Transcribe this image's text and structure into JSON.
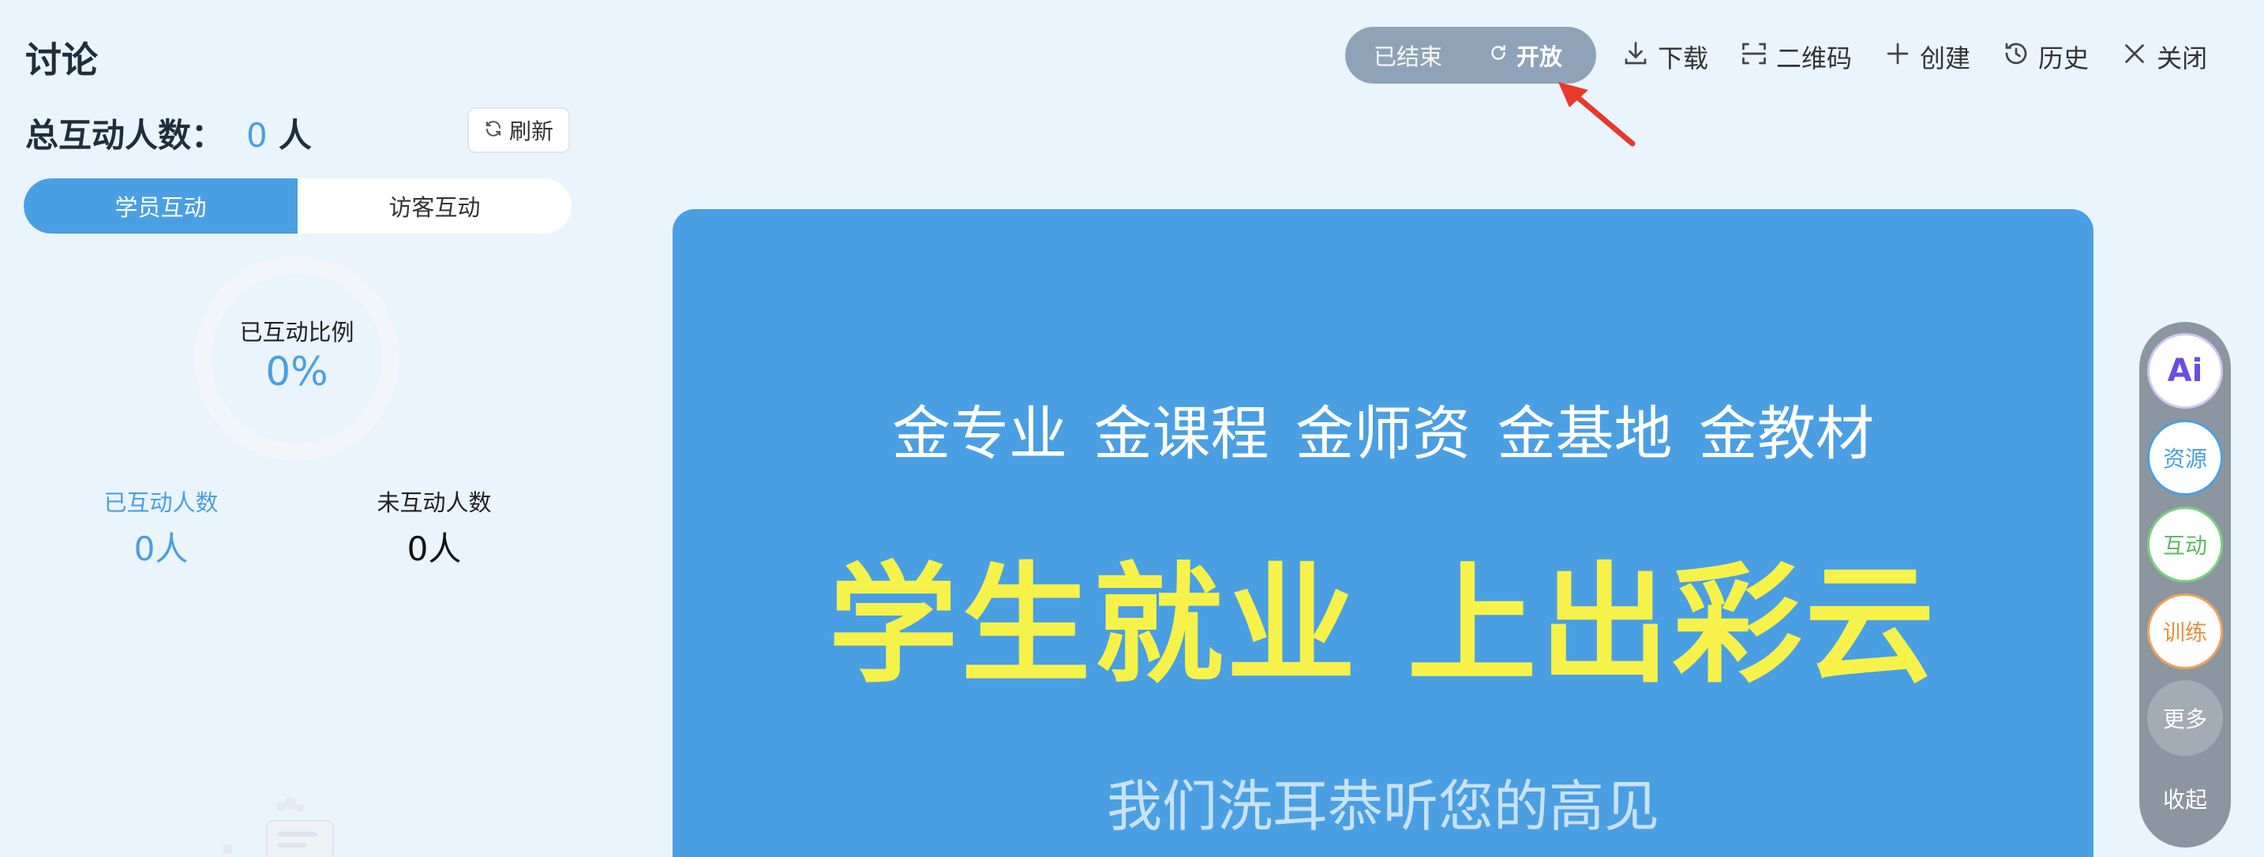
{
  "panel": {
    "title": "讨论",
    "total_label": "总互动人数：",
    "total_value": "0",
    "total_unit": "人",
    "refresh_label": "刷新",
    "tabs": [
      {
        "label": "学员互动",
        "active": true
      },
      {
        "label": "访客互动",
        "active": false
      }
    ],
    "ratio_label": "已互动比例",
    "ratio_value": "0%",
    "interacted_label": "已互动人数",
    "interacted_value": "0人",
    "not_interacted_label": "未互动人数",
    "not_interacted_value": "0人"
  },
  "toolbar": {
    "status_ended": "已结束",
    "open_label": "开放",
    "download_label": "下载",
    "qrcode_label": "二维码",
    "create_label": "创建",
    "history_label": "历史",
    "close_label": "关闭"
  },
  "slide": {
    "line1": "金专业  金课程  金师资  金基地  金教材",
    "line2": "学生就业  上出彩云",
    "line3": "我们洗耳恭听您的高见"
  },
  "dock": {
    "ai_label": "Ai",
    "resources_label": "资源",
    "interaction_label": "互动",
    "training_label": "训练",
    "more_label": "更多",
    "collapse_label": "收起"
  },
  "colors": {
    "accent": "#4a9fe3",
    "background": "#eaf4fd",
    "slide_highlight": "#f6f24a",
    "annotation_arrow": "#e8392a"
  }
}
